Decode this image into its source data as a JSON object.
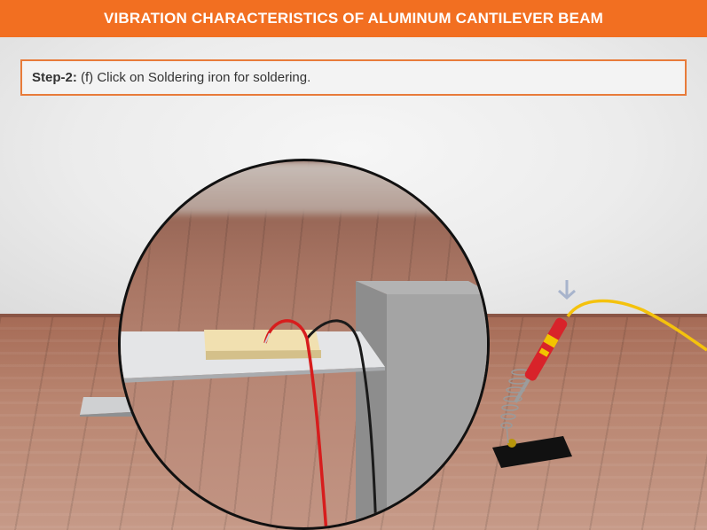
{
  "header": {
    "title": "VIBRATION CHARACTERISTICS OF ALUMINUM CANTILEVER BEAM"
  },
  "instruction": {
    "step_label": "Step-2:",
    "text": " (f) Click on Soldering iron for soldering."
  },
  "scene": {
    "zoom_view": "magnified-beam-sensor-view",
    "tools": [
      "soldering-iron",
      "soldering-iron-stand"
    ]
  },
  "colors": {
    "header_bg": "#f26f21",
    "instruction_border": "#e87b3a",
    "wire_red": "#d71d1d",
    "wire_black": "#1a1a1a",
    "iron_red": "#d8232a",
    "iron_yellow": "#f2c400",
    "cable_yellow": "#f4c20d",
    "hint_arrow": "#a8b4cc"
  }
}
